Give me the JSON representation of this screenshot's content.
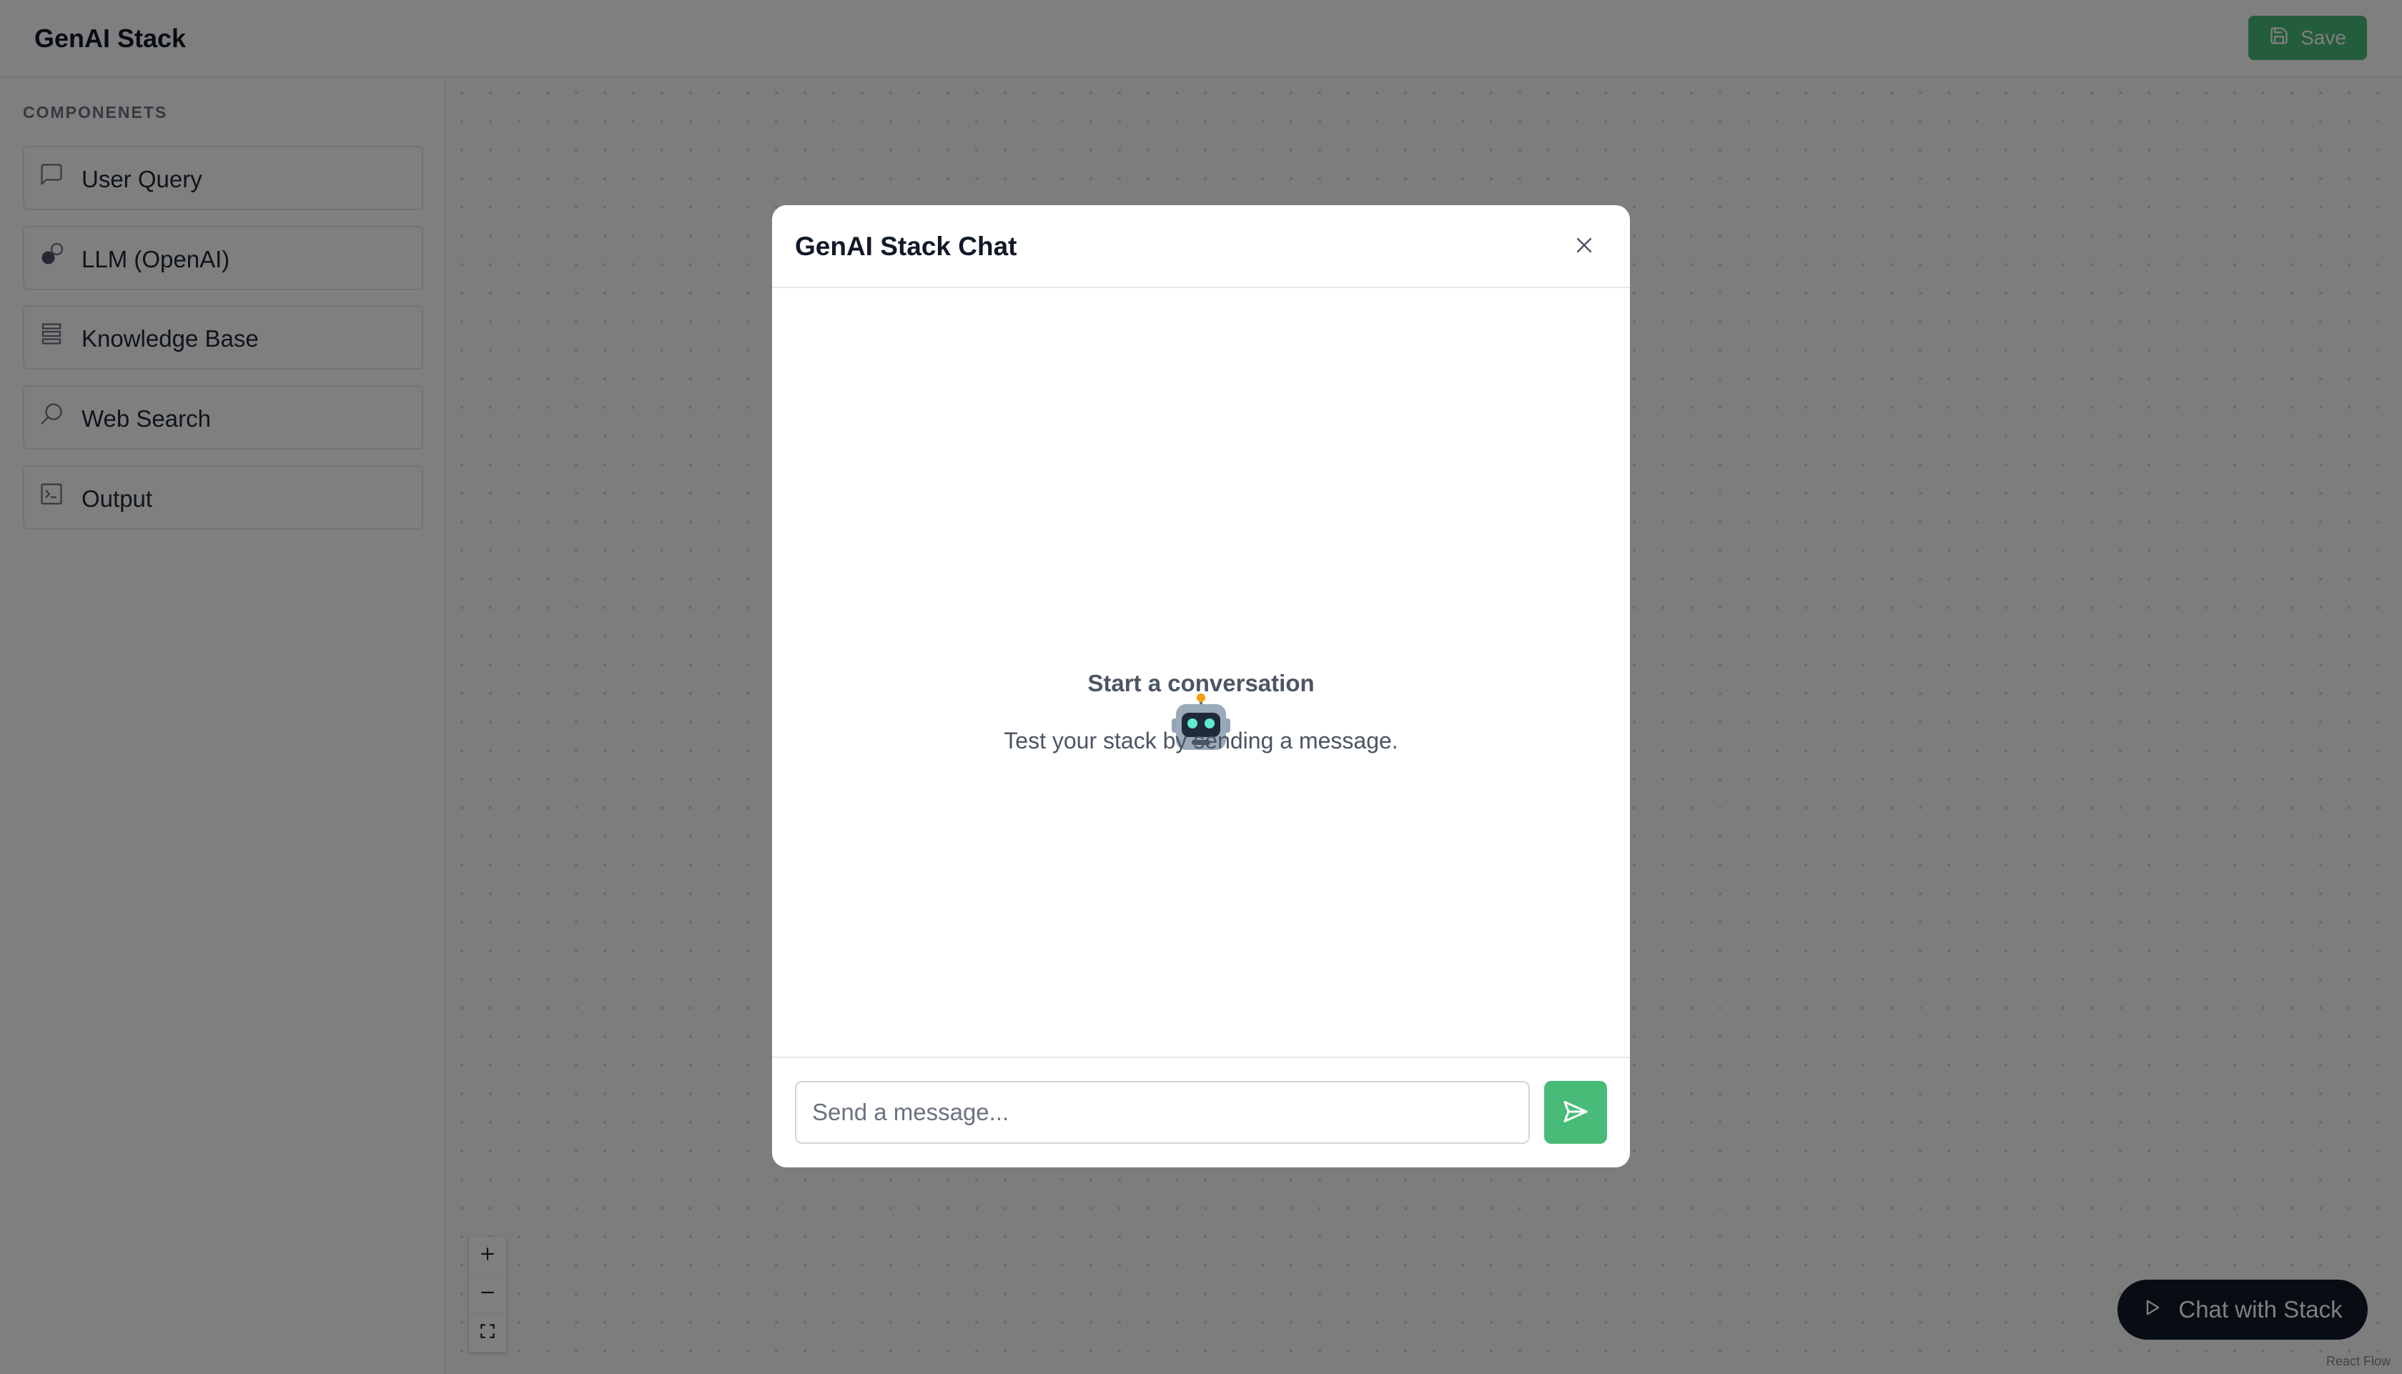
{
  "header": {
    "app_title": "GenAI Stack",
    "save_label": "Save"
  },
  "sidebar": {
    "heading": "COMPONENETS",
    "items": [
      {
        "label": "User Query",
        "icon": "message-square-icon"
      },
      {
        "label": "LLM (OpenAI)",
        "icon": "openai-icon"
      },
      {
        "label": "Knowledge Base",
        "icon": "database-icon"
      },
      {
        "label": "Web Search",
        "icon": "search-icon"
      },
      {
        "label": "Output",
        "icon": "terminal-icon"
      }
    ]
  },
  "canvas": {
    "chat_button_label": "Chat with Stack",
    "attribution": "React Flow",
    "zoom_controls": [
      "zoom-in-icon",
      "zoom-out-icon",
      "fit-view-icon"
    ]
  },
  "modal": {
    "title": "GenAI Stack Chat",
    "empty_icon": "🤖",
    "empty_title": "Start a conversation",
    "empty_subtitle": "Test your stack by sending a message.",
    "input_placeholder": "Send a message...",
    "input_value": ""
  },
  "colors": {
    "accent": "#48bb78",
    "dark_button": "#111827",
    "overlay": "rgba(0,0,0,0.5)"
  }
}
